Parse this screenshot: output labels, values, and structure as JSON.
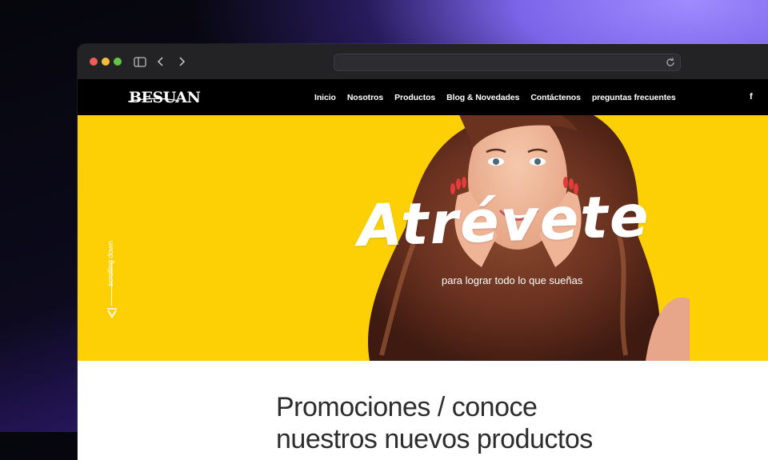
{
  "brand": {
    "logo": "BESUAN"
  },
  "nav": {
    "items": [
      {
        "label": "Inicio"
      },
      {
        "label": "Nosotros"
      },
      {
        "label": "Productos"
      },
      {
        "label": "Blog & Novedades"
      },
      {
        "label": "Contáctenos"
      },
      {
        "label": "preguntas frecuentes"
      }
    ],
    "social": "f"
  },
  "hero": {
    "title": "Atrévete",
    "subtitle": "para lograr todo lo que sueñas",
    "scroll_label": "scrolling down",
    "background": "#fdd006"
  },
  "section": {
    "heading_line1": "Promociones / conoce",
    "heading_line2": "nuestros nuevos productos"
  },
  "colors": {
    "nav_bg": "#000000",
    "accent": "#fdd006"
  }
}
